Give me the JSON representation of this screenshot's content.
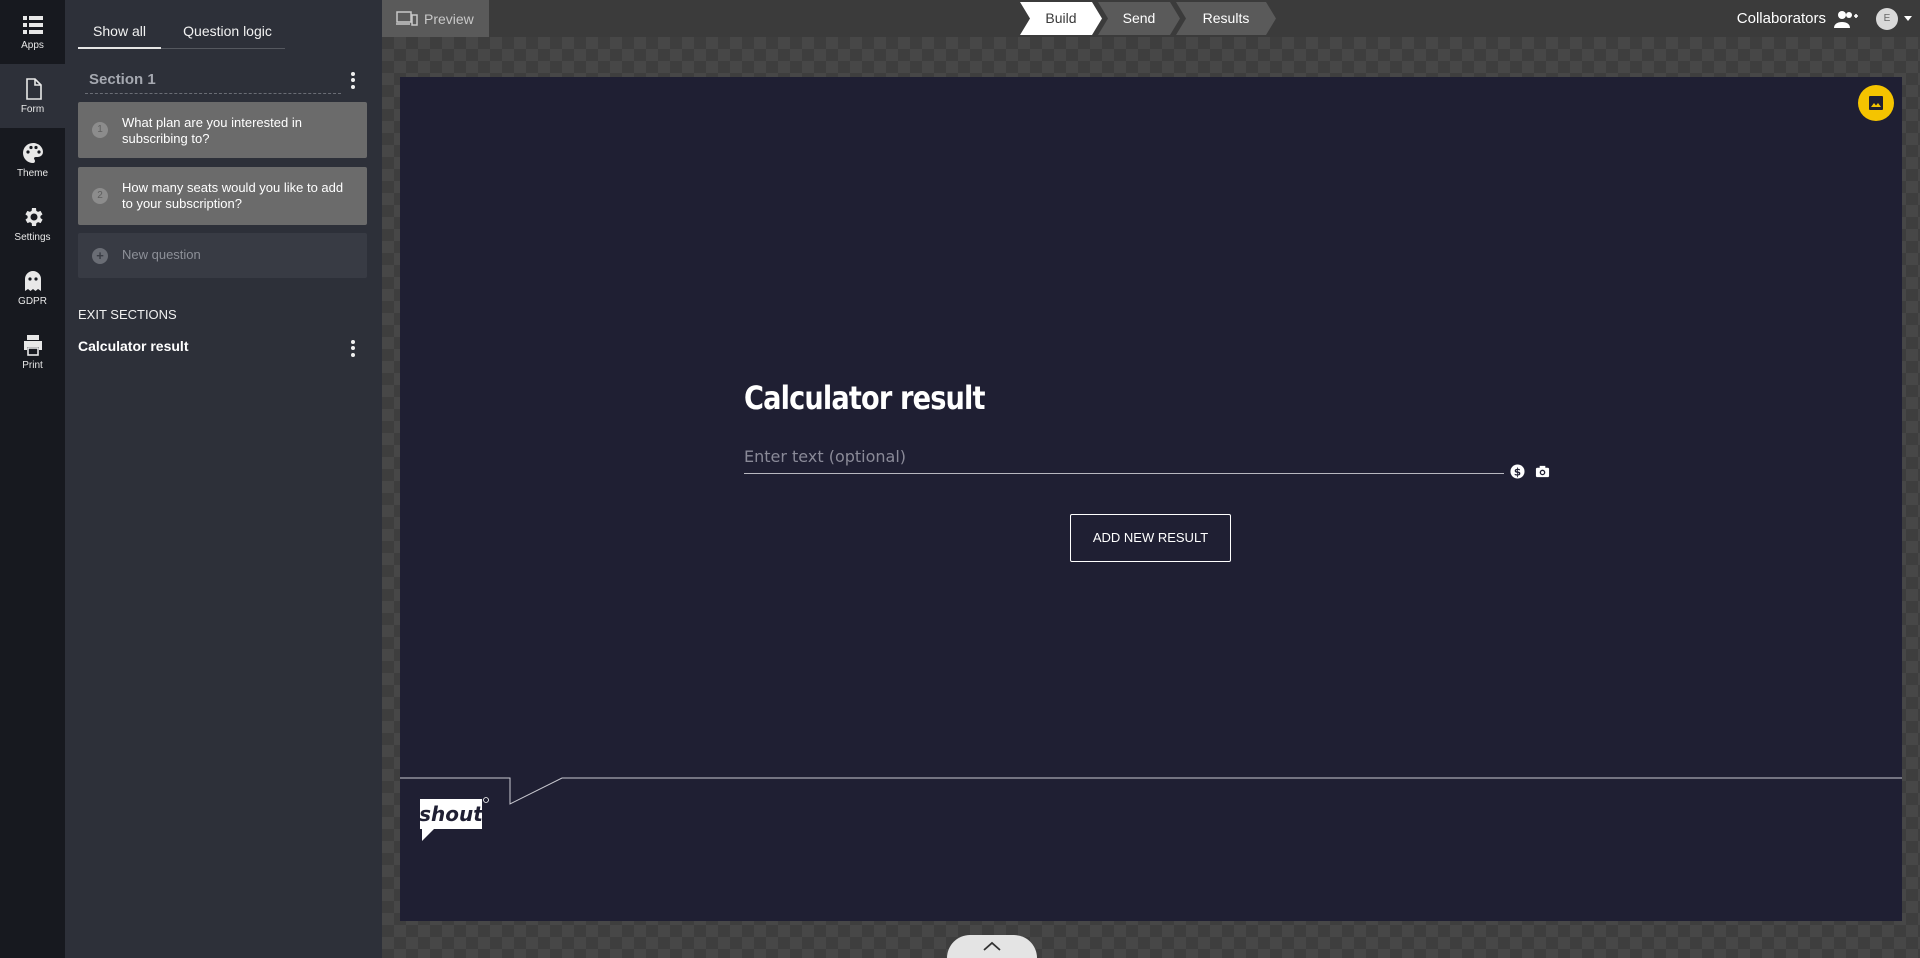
{
  "rail": {
    "items": [
      {
        "label": "Apps",
        "icon": "apps-grid-icon"
      },
      {
        "label": "Form",
        "icon": "document-icon"
      },
      {
        "label": "Theme",
        "icon": "palette-icon"
      },
      {
        "label": "Settings",
        "icon": "gear-icon"
      },
      {
        "label": "GDPR",
        "icon": "ghost-icon"
      },
      {
        "label": "Print",
        "icon": "printer-icon"
      }
    ]
  },
  "panel": {
    "tabs": [
      "Show all",
      "Question logic"
    ],
    "section_title": "Section 1",
    "questions": [
      {
        "num": "1",
        "text": "What plan are you interested in subscribing to?"
      },
      {
        "num": "2",
        "text": "How many seats would you like to add to your subscription?"
      }
    ],
    "new_question": "New question",
    "exit_label": "EXIT SECTIONS",
    "exit_item": "Calculator result"
  },
  "topbar": {
    "preview_label": "Preview",
    "steps": [
      "Build",
      "Send",
      "Results"
    ],
    "collaborators_label": "Collaborators",
    "avatar_initial": "E"
  },
  "form": {
    "title": "Calculator result",
    "input_placeholder": "Enter text (optional)",
    "input_icons": [
      "dollar-icon",
      "camera-icon"
    ],
    "add_button": "ADD NEW RESULT",
    "logo_text": "shout"
  },
  "colors": {
    "rail_bg": "#17191f",
    "panel_bg": "#2d3039",
    "form_bg": "#1f1f33",
    "accent_yellow": "#f5c400"
  }
}
